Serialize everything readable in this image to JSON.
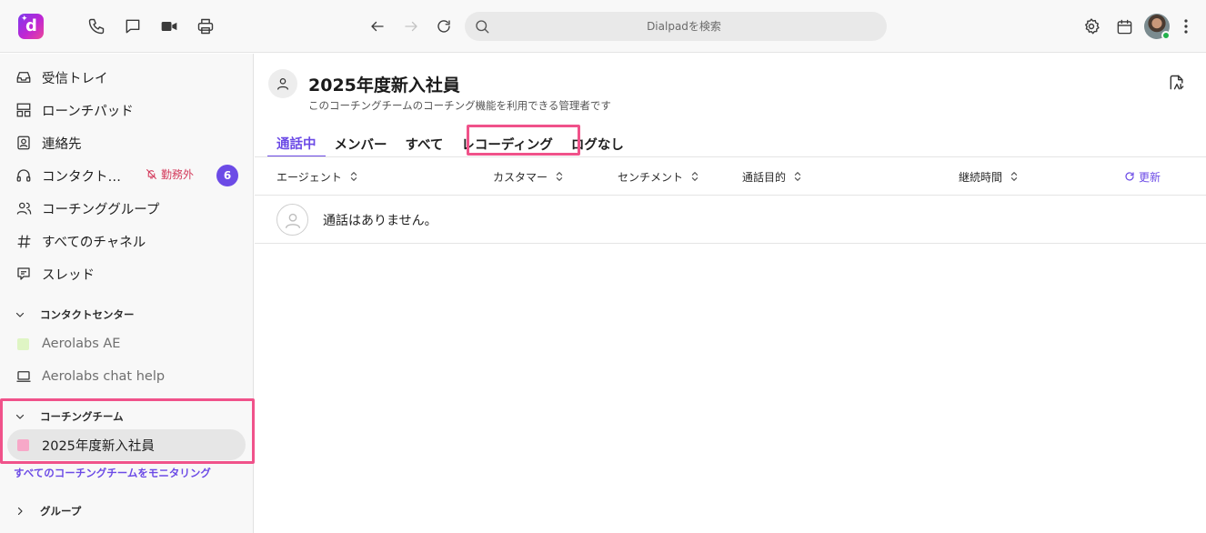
{
  "topbar": {
    "search_placeholder": "Dialpadを検索",
    "icons": [
      "phone-icon",
      "chat-icon",
      "video-icon",
      "print-icon",
      "back-arrow-icon",
      "forward-arrow-icon",
      "reload-icon",
      "search-icon",
      "gear-icon",
      "calendar-icon",
      "more-vertical-icon"
    ]
  },
  "sidebar": {
    "items": [
      {
        "label": "受信トレイ",
        "icon": "inbox-icon"
      },
      {
        "label": "ローンチパッド",
        "icon": "launchpad-icon"
      },
      {
        "label": "連絡先",
        "icon": "contacts-icon"
      },
      {
        "label": "コンタクト…",
        "icon": "headset-icon",
        "status": "勤務外",
        "badge": "6"
      },
      {
        "label": "コーチンググループ",
        "icon": "people-icon"
      },
      {
        "label": "すべてのチャネル",
        "icon": "hash-icon"
      },
      {
        "label": "スレッド",
        "icon": "threads-icon"
      }
    ],
    "contact_center": {
      "header": "コンタクトセンター",
      "items": [
        {
          "label": "Aerolabs AE",
          "color": "#dff5c4"
        },
        {
          "label": "Aerolabs chat help",
          "icon": "laptop-icon"
        }
      ]
    },
    "coaching_teams": {
      "header": "コーチングチーム",
      "items": [
        {
          "label": "2025年度新入社員",
          "color": "#f7a8c8"
        }
      ],
      "monitor_link": "すべてのコーチングチームをモニタリング"
    },
    "groups": {
      "header": "グループ"
    }
  },
  "main": {
    "title": "2025年度新入社員",
    "description": "このコーチングチームのコーチング機能を利用できる管理者です",
    "tabs": [
      {
        "label": "通話中",
        "active": true
      },
      {
        "label": "メンバー"
      },
      {
        "label": "すべて"
      },
      {
        "label": "レコーディング"
      },
      {
        "label": "ログなし"
      }
    ],
    "table": {
      "columns": [
        "エージェント",
        "カスタマー",
        "センチメント",
        "通話目的",
        "継続時間"
      ],
      "refresh_label": "更新",
      "empty_message": "通話はありません。"
    }
  },
  "colors": {
    "accent": "#6c4be6",
    "highlight": "#f0528a",
    "off_duty": "#d33a5b"
  }
}
